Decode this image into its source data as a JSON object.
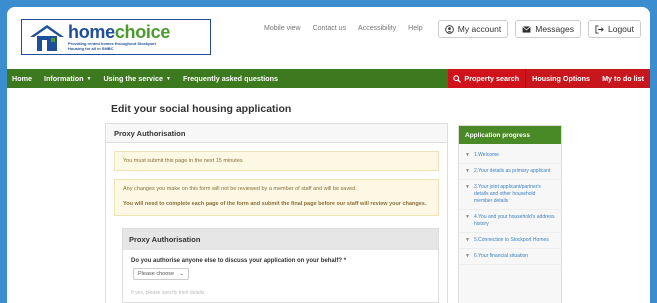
{
  "logo": {
    "name_part1": "home",
    "name_part2": "choice",
    "tagline": "Providing rented homes throughout Stockport",
    "tagline2": "Housing for all in SMBC"
  },
  "toplinks": [
    "Mobile view",
    "Contact us",
    "Accessibility",
    "Help"
  ],
  "account": {
    "my_account": "My account",
    "messages": "Messages",
    "logout": "Logout"
  },
  "nav": {
    "home": "Home",
    "information": "Information",
    "using_service": "Using the service",
    "faq": "Frequently asked questions",
    "property_search": "Property search",
    "housing_options": "Housing Options",
    "todo": "My to do list"
  },
  "page_title": "Edit your social housing application",
  "section_title": "Proxy Authorisation",
  "notice1": "You must submit this page in the next 15 minutes",
  "notice2": {
    "line1": "Any changes you make on this form will not be reviewed by a member of staff and will be saved.",
    "line2": "You will need to complete each page of the form and submit the final page before our staff will review your changes."
  },
  "panel": {
    "title": "Proxy Authorisation",
    "question": "Do you authorise anyone else to discuss your application on your behalf? *",
    "select_value": "Please choose",
    "faint": "If yes, please specify their details"
  },
  "progress": {
    "title": "Application progress",
    "items": [
      "1.Welcome",
      "2.Your details as primary applicant",
      "3.Your joint applicant/partner's details and other household member details",
      "4.You and your household's address history",
      "5.Connection to Stockport Homes",
      "6.Your financial situation"
    ]
  },
  "colors": {
    "nav_green": "#3d7a1f",
    "nav_red": "#c8161d",
    "border_blue": "#3a8ed0"
  }
}
